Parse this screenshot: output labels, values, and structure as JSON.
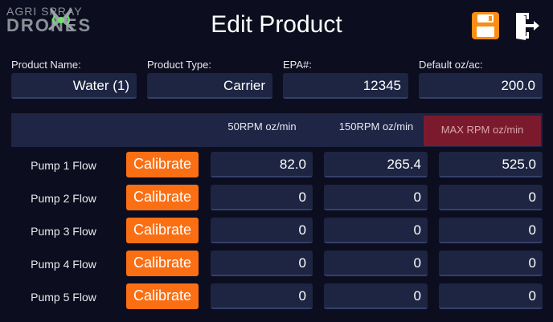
{
  "header": {
    "logo_top": "AGRI SPRAY",
    "logo_bottom": "DRONES",
    "title": "Edit Product",
    "save_icon": "save-icon",
    "exit_icon": "exit-icon",
    "accent": "#fb8c14"
  },
  "fields": {
    "product_name": {
      "label": "Product Name:",
      "value": "Water (1)"
    },
    "product_type": {
      "label": "Product Type:",
      "value": "Carrier"
    },
    "epa": {
      "label": "EPA#:",
      "value": "12345"
    },
    "default_oz_ac": {
      "label": "Default oz/ac:",
      "value": "200.0"
    }
  },
  "rpm_columns": [
    "50RPM oz/min",
    "150RPM oz/min",
    "MAX RPM oz/min"
  ],
  "calibrate_label": "Calibrate",
  "pumps": [
    {
      "label": "Pump 1 Flow",
      "values": [
        "82.0",
        "265.4",
        "525.0"
      ]
    },
    {
      "label": "Pump 2 Flow",
      "values": [
        "0",
        "0",
        "0"
      ]
    },
    {
      "label": "Pump 3 Flow",
      "values": [
        "0",
        "0",
        "0"
      ]
    },
    {
      "label": "Pump 4 Flow",
      "values": [
        "0",
        "0",
        "0"
      ]
    },
    {
      "label": "Pump 5 Flow",
      "values": [
        "0",
        "0",
        "0"
      ]
    }
  ],
  "colors": {
    "background": "#0c0e1f",
    "field": "#1d2542",
    "calibrate": "#fb6f14",
    "max_rpm": "#7c1a2d"
  }
}
